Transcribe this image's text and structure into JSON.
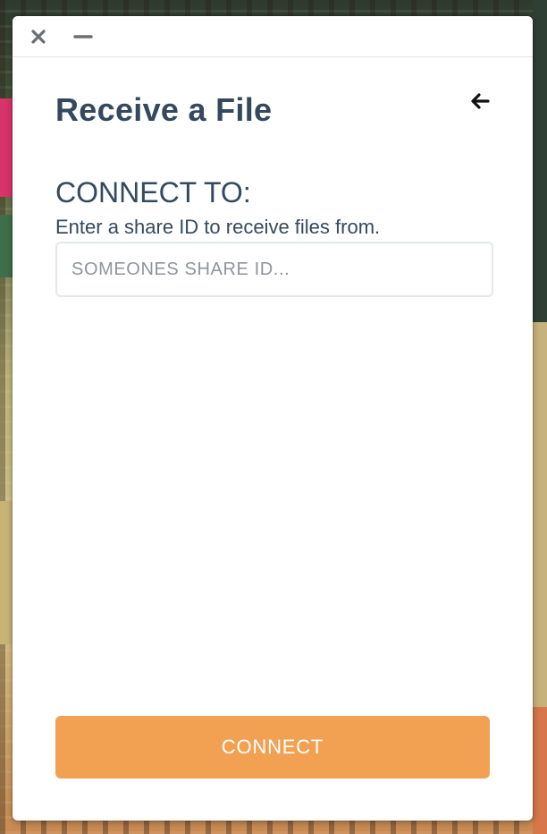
{
  "window": {
    "controls": {
      "close_icon": "close-icon",
      "minimize_icon": "minimize-icon"
    }
  },
  "header": {
    "title": "Receive a File",
    "back_icon": "arrow-left-icon"
  },
  "form": {
    "section_label": "CONNECT TO:",
    "help_text": "Enter a share ID to receive files from.",
    "share_id": {
      "value": "",
      "placeholder": "SOMEONES SHARE ID..."
    },
    "connect_label": "CONNECT"
  },
  "colors": {
    "text": "#34495e",
    "accent": "#f2a152",
    "input_border": "#e5e8eb",
    "window_bg": "#ffffff"
  }
}
